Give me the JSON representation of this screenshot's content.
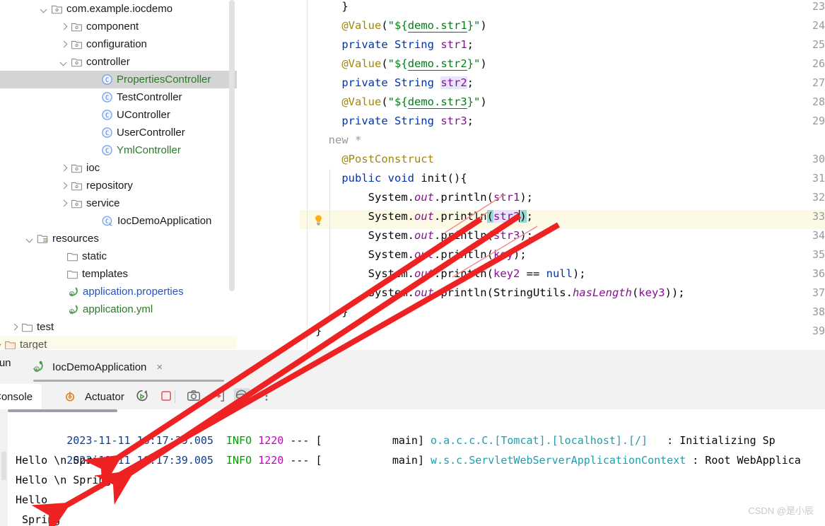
{
  "project_tree": {
    "rows": [
      {
        "label": "com.example.iocdemo",
        "indent": 56,
        "arrow": "open",
        "icon": "package-icon",
        "color": "black"
      },
      {
        "label": "component",
        "indent": 84,
        "arrow": "closed",
        "icon": "package-icon",
        "color": "black"
      },
      {
        "label": "configuration",
        "indent": 84,
        "arrow": "closed",
        "icon": "package-icon",
        "color": "black"
      },
      {
        "label": "controller",
        "indent": 84,
        "arrow": "open",
        "icon": "package-icon",
        "color": "black"
      },
      {
        "label": "PropertiesController",
        "indent": 127,
        "arrow": "none",
        "icon": "java-class-icon",
        "color": "green",
        "selected": true
      },
      {
        "label": "TestController",
        "indent": 127,
        "arrow": "none",
        "icon": "java-class-icon",
        "color": "black"
      },
      {
        "label": "UController",
        "indent": 127,
        "arrow": "none",
        "icon": "java-class-icon",
        "color": "black"
      },
      {
        "label": "UserController",
        "indent": 127,
        "arrow": "none",
        "icon": "java-class-icon",
        "color": "black"
      },
      {
        "label": "YmlController",
        "indent": 127,
        "arrow": "none",
        "icon": "java-class-icon",
        "color": "green"
      },
      {
        "label": "ioc",
        "indent": 84,
        "arrow": "closed",
        "icon": "package-icon",
        "color": "black"
      },
      {
        "label": "repository",
        "indent": 84,
        "arrow": "closed",
        "icon": "package-icon",
        "color": "black"
      },
      {
        "label": "service",
        "indent": 84,
        "arrow": "closed",
        "icon": "package-icon",
        "color": "black"
      },
      {
        "label": "IocDemoApplication",
        "indent": 127,
        "arrow": "none",
        "icon": "spring-class-icon",
        "color": "black"
      },
      {
        "label": "resources",
        "indent": 36,
        "arrow": "open",
        "icon": "resources-folder-icon",
        "color": "black"
      },
      {
        "label": "static",
        "indent": 78,
        "arrow": "none",
        "icon": "folder-icon",
        "color": "black"
      },
      {
        "label": "templates",
        "indent": 78,
        "arrow": "none",
        "icon": "folder-icon",
        "color": "black"
      },
      {
        "label": "application.properties",
        "indent": 78,
        "arrow": "none",
        "icon": "spring-config-icon",
        "color": "blue"
      },
      {
        "label": "application.yml",
        "indent": 78,
        "arrow": "none",
        "icon": "spring-config-icon",
        "color": "green"
      },
      {
        "label": "test",
        "indent": 14,
        "arrow": "closed",
        "icon": "folder-icon",
        "color": "black"
      },
      {
        "label": "target",
        "indent": -10,
        "arrow": "closed",
        "icon": "excluded-folder-icon",
        "color": "grey",
        "excluded": true
      }
    ]
  },
  "editor": {
    "line_numbers": [
      "23",
      "24",
      "25",
      "26",
      "27",
      "28",
      "29",
      "30",
      "31",
      "32",
      "33",
      "34",
      "35",
      "36",
      "37",
      "38",
      "39"
    ],
    "highlighted_line": "33",
    "inlay_hint": "new *",
    "gutter_icon": "intention-bulb-icon",
    "lines": [
      {
        "num": "23",
        "text": "    }"
      },
      {
        "num": "24",
        "text": "    @Value(\"${demo.str1}\")"
      },
      {
        "num": "25",
        "text": "    private String str1;"
      },
      {
        "num": "26",
        "text": "    @Value(\"${demo.str2}\")"
      },
      {
        "num": "27",
        "text": "    private String str2;"
      },
      {
        "num": "28",
        "text": "    @Value(\"${demo.str3}\")"
      },
      {
        "num": "29",
        "text": "    private String str3;"
      },
      {
        "num": "30",
        "text": "    @PostConstruct"
      },
      {
        "num": "31",
        "text": "    public void init(){"
      },
      {
        "num": "32",
        "text": "        System.out.println(str1);"
      },
      {
        "num": "33",
        "text": "        System.out.println(str2);"
      },
      {
        "num": "34",
        "text": "        System.out.println(str3);"
      },
      {
        "num": "35",
        "text": "        System.out.println(key);"
      },
      {
        "num": "36",
        "text": "        System.out.println(key2 == null);"
      },
      {
        "num": "37",
        "text": "        System.out.println(StringUtils.hasLength(key3));"
      },
      {
        "num": "38",
        "text": "    }"
      },
      {
        "num": "39",
        "text": "}"
      }
    ]
  },
  "run_window": {
    "title": "Run",
    "tab_label": "IocDemoApplication",
    "tab_icon": "spring-boot-run-icon",
    "tab_close": "×",
    "console_tab_label": "Console",
    "actuator_tab_label": "Actuator",
    "actuator_icon": "actuator-icon",
    "buttons": [
      {
        "name": "rerun-button",
        "title": "Rerun"
      },
      {
        "name": "stop-button",
        "title": "Stop"
      },
      {
        "name": "camera-button",
        "title": "Snapshot"
      },
      {
        "name": "export-button",
        "title": "Export"
      },
      {
        "name": "thread-dump-button",
        "title": "Thread Dump"
      },
      {
        "name": "more-options-button",
        "title": "More"
      }
    ]
  },
  "console": {
    "lines": [
      {
        "type": "log",
        "time": "2023-11-11 16:17:39.005",
        "level": "INFO",
        "pid": "1220",
        "dashes": "---",
        "thread": "[           main]",
        "logger": "o.a.c.c.C.[Tomcat].[localhost].[/]",
        "sep": ":",
        "message": "Initializing Sp"
      },
      {
        "type": "log",
        "time": "2023-11-11 16:17:39.005",
        "level": "INFO",
        "pid": "1220",
        "dashes": "---",
        "thread": "[           main]",
        "logger": "w.s.c.ServletWebServerApplicationContext",
        "sep": ":",
        "message": "Root WebApplica"
      },
      {
        "type": "out",
        "text": "Hello \\n Spring"
      },
      {
        "type": "out",
        "text": "Hello \\n Spring"
      },
      {
        "type": "out",
        "text": "Hello"
      },
      {
        "type": "out",
        "text": " Spring"
      }
    ]
  },
  "watermark": {
    "text": "CSDN @是小辰"
  },
  "annotations": {
    "arrow_color": "#ee2222",
    "count": 3
  }
}
